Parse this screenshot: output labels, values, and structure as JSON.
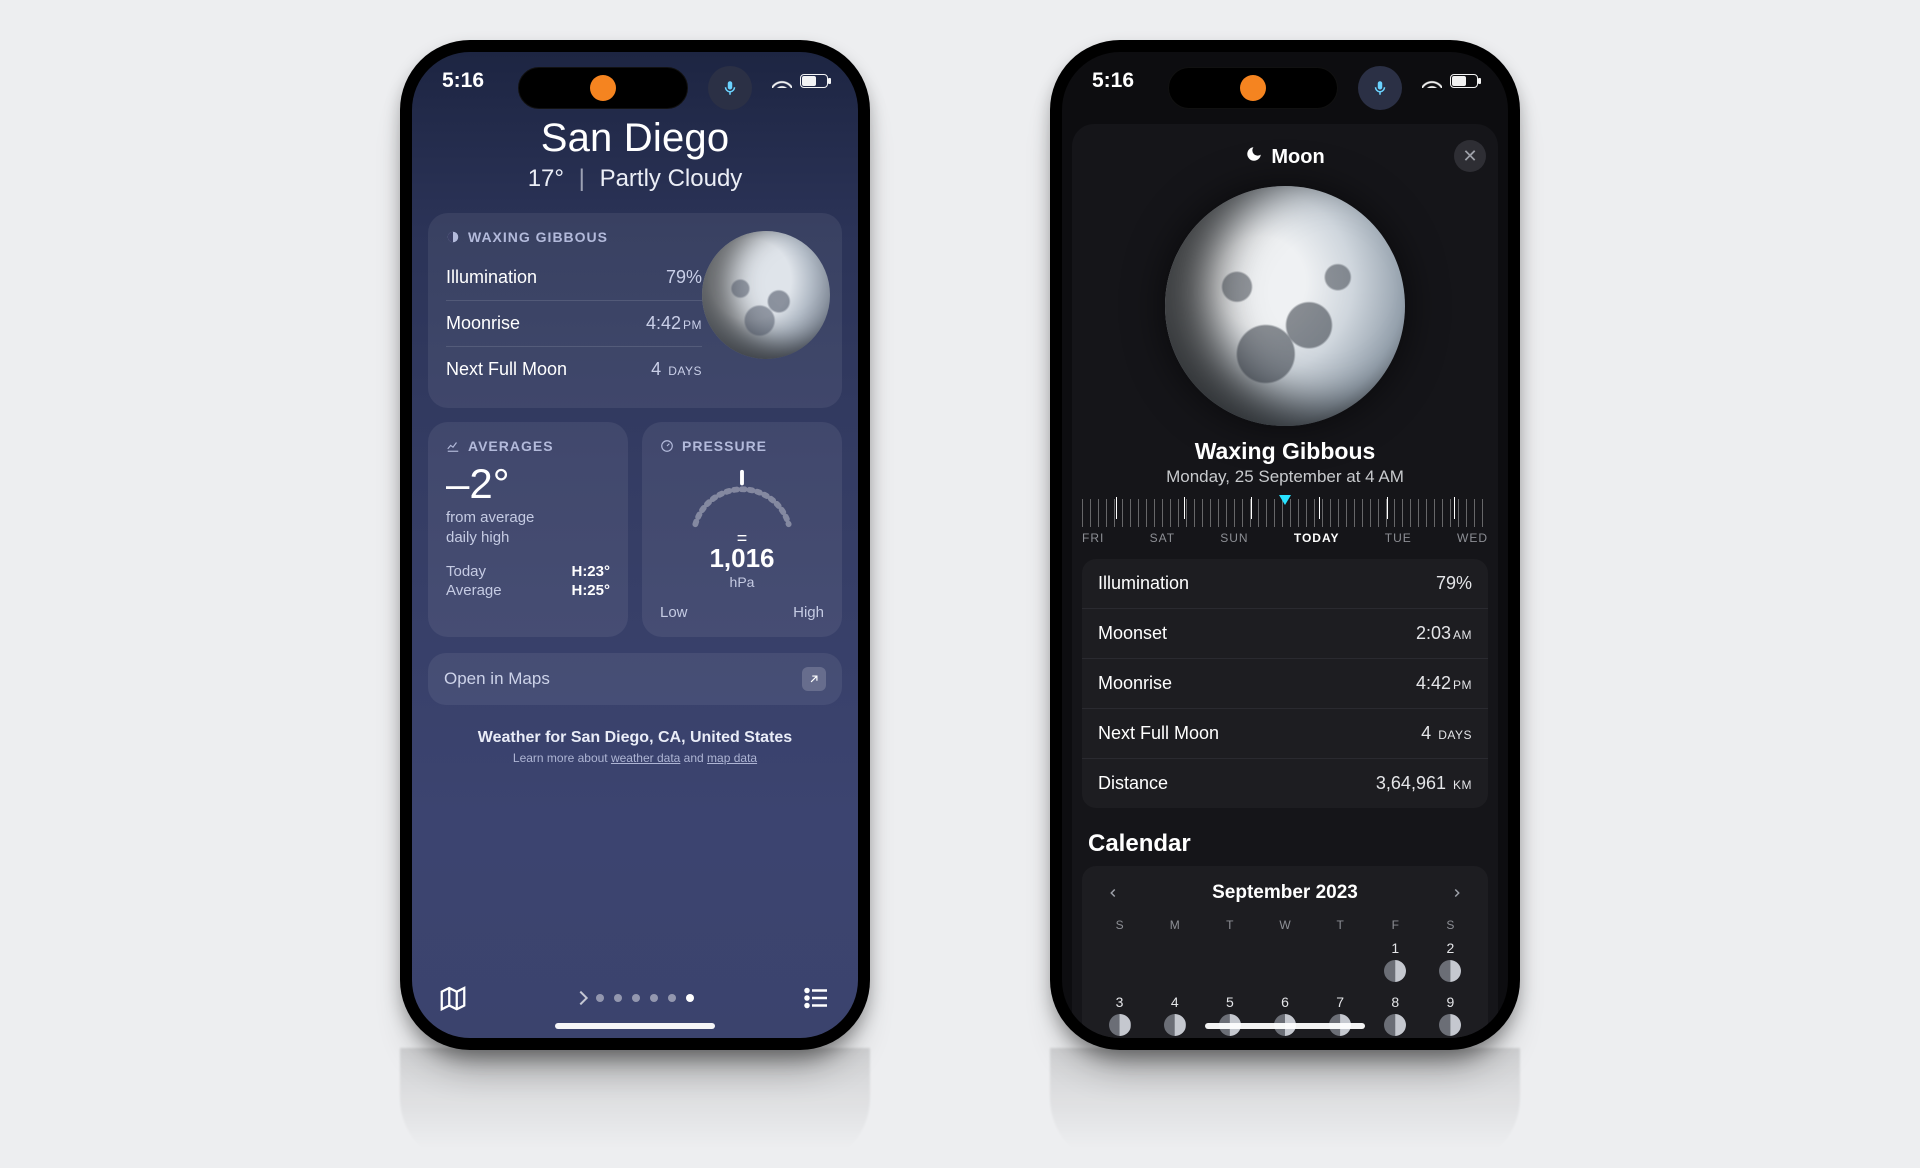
{
  "statusBar": {
    "time": "5:16"
  },
  "phoneA": {
    "header": {
      "city": "San Diego",
      "temp": "17°",
      "condition": "Partly Cloudy"
    },
    "moonCard": {
      "title": "WAXING GIBBOUS",
      "rows": {
        "illumination": {
          "label": "Illumination",
          "value": "79%"
        },
        "moonrise": {
          "label": "Moonrise",
          "value": "4:42",
          "unit": "PM"
        },
        "nextFull": {
          "label": "Next Full Moon",
          "value": "4",
          "unit": "DAYS"
        }
      }
    },
    "averages": {
      "title": "AVERAGES",
      "delta": "–2°",
      "caption1": "from average",
      "caption2": "daily high",
      "todayLabel": "Today",
      "todayValue": "H:23°",
      "averageLabel": "Average",
      "averageValue": "H:25°"
    },
    "pressure": {
      "title": "PRESSURE",
      "equal": "=",
      "value": "1,016",
      "unit": "hPa",
      "low": "Low",
      "high": "High"
    },
    "openInMaps": "Open in Maps",
    "footer": {
      "line1": "Weather for San Diego, CA, United States",
      "learn": "Learn more about ",
      "weather_data": "weather data",
      "and": " and ",
      "map_data": "map data"
    }
  },
  "phoneB": {
    "sheetTitle": "Moon",
    "phase": "Waxing Gibbous",
    "date": "Monday, 25 September at 4 AM",
    "ticks": {
      "fri": "FRI",
      "sat": "SAT",
      "sun": "SUN",
      "today": "TODAY",
      "tue": "TUE",
      "wed": "WED"
    },
    "rows": {
      "illumination": {
        "label": "Illumination",
        "value": "79%"
      },
      "moonset": {
        "label": "Moonset",
        "value": "2:03",
        "unit": "AM"
      },
      "moonrise": {
        "label": "Moonrise",
        "value": "4:42",
        "unit": "PM"
      },
      "nextFull": {
        "label": "Next Full Moon",
        "value": "4",
        "unit": "DAYS"
      },
      "distance": {
        "label": "Distance",
        "value": "3,64,961",
        "unit": "KM"
      }
    },
    "calendar": {
      "heading": "Calendar",
      "month": "September 2023",
      "dow": [
        "S",
        "M",
        "T",
        "W",
        "T",
        "F",
        "S"
      ],
      "row1": [
        "",
        "",
        "",
        "",
        "",
        "1",
        "2"
      ],
      "row2": [
        "3",
        "4",
        "5",
        "6",
        "7",
        "8",
        "9"
      ]
    }
  }
}
